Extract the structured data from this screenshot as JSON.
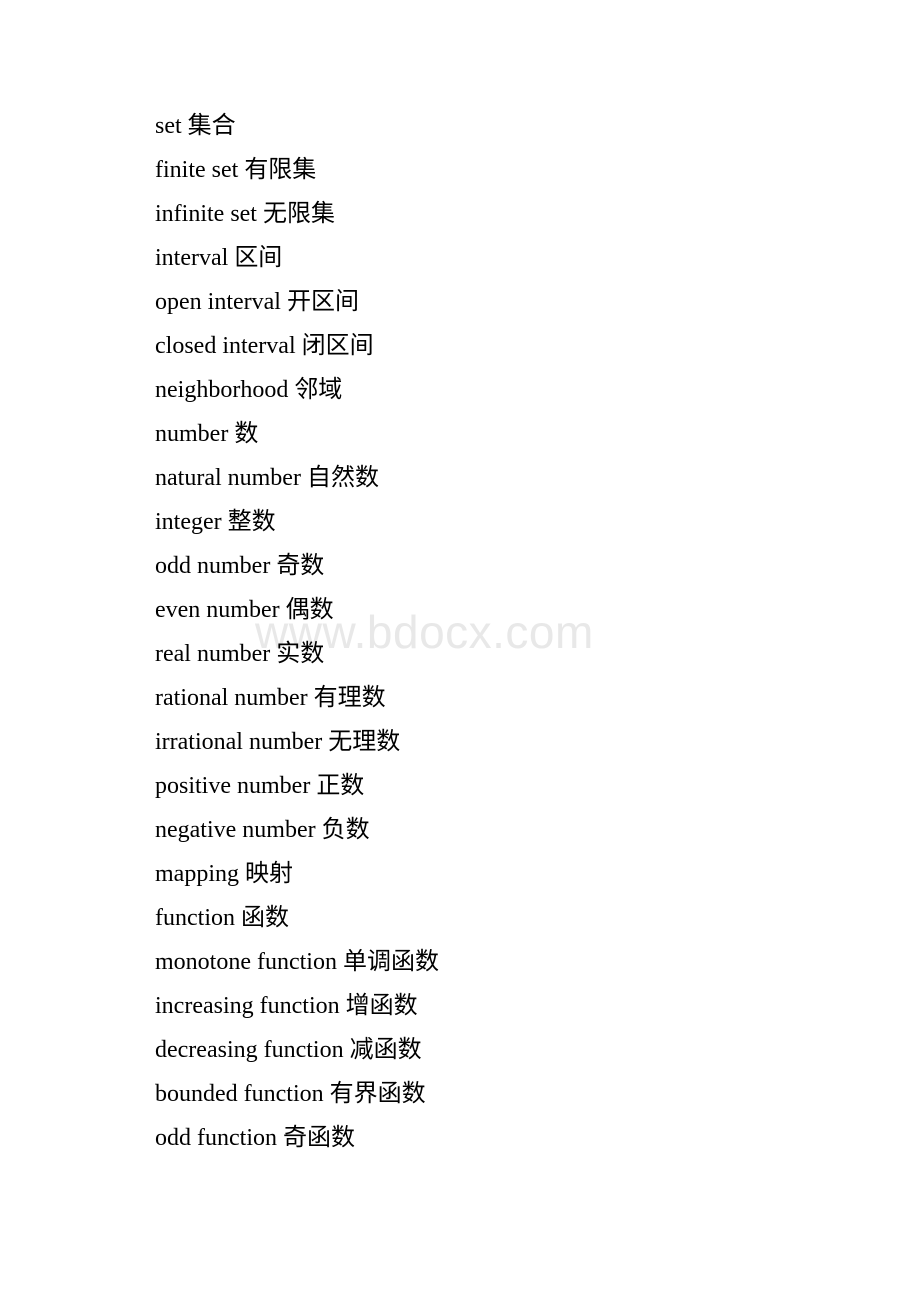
{
  "document": {
    "type": "glossary",
    "background_color": "#ffffff",
    "text_color": "#000000"
  },
  "watermark": {
    "text": "www.bdocx.com",
    "color": "#e8e8e8"
  },
  "glossary": {
    "entries": [
      {
        "term": "set",
        "gloss": "集合"
      },
      {
        "term": "finite set",
        "gloss": "有限集"
      },
      {
        "term": "infinite set",
        "gloss": "无限集"
      },
      {
        "term": "interval",
        "gloss": "区间"
      },
      {
        "term": "open interval",
        "gloss": "开区间"
      },
      {
        "term": "closed interval",
        "gloss": "闭区间"
      },
      {
        "term": "neighborhood",
        "gloss": "邻域"
      },
      {
        "term": "number",
        "gloss": "数"
      },
      {
        "term": "natural number",
        "gloss": "自然数"
      },
      {
        "term": "integer",
        "gloss": "整数"
      },
      {
        "term": "odd number",
        "gloss": "奇数"
      },
      {
        "term": "even number",
        "gloss": "偶数"
      },
      {
        "term": "real number",
        "gloss": "实数"
      },
      {
        "term": "rational number",
        "gloss": "有理数"
      },
      {
        "term": "irrational number",
        "gloss": "无理数"
      },
      {
        "term": "positive number",
        "gloss": "正数"
      },
      {
        "term": "negative number",
        "gloss": "负数"
      },
      {
        "term": "mapping",
        "gloss": "映射"
      },
      {
        "term": "function",
        "gloss": "函数"
      },
      {
        "term": "monotone function",
        "gloss": "单调函数"
      },
      {
        "term": "increasing function",
        "gloss": "增函数"
      },
      {
        "term": "decreasing function",
        "gloss": "减函数"
      },
      {
        "term": "bounded function",
        "gloss": "有界函数"
      },
      {
        "term": "odd function",
        "gloss": "奇函数"
      }
    ]
  }
}
